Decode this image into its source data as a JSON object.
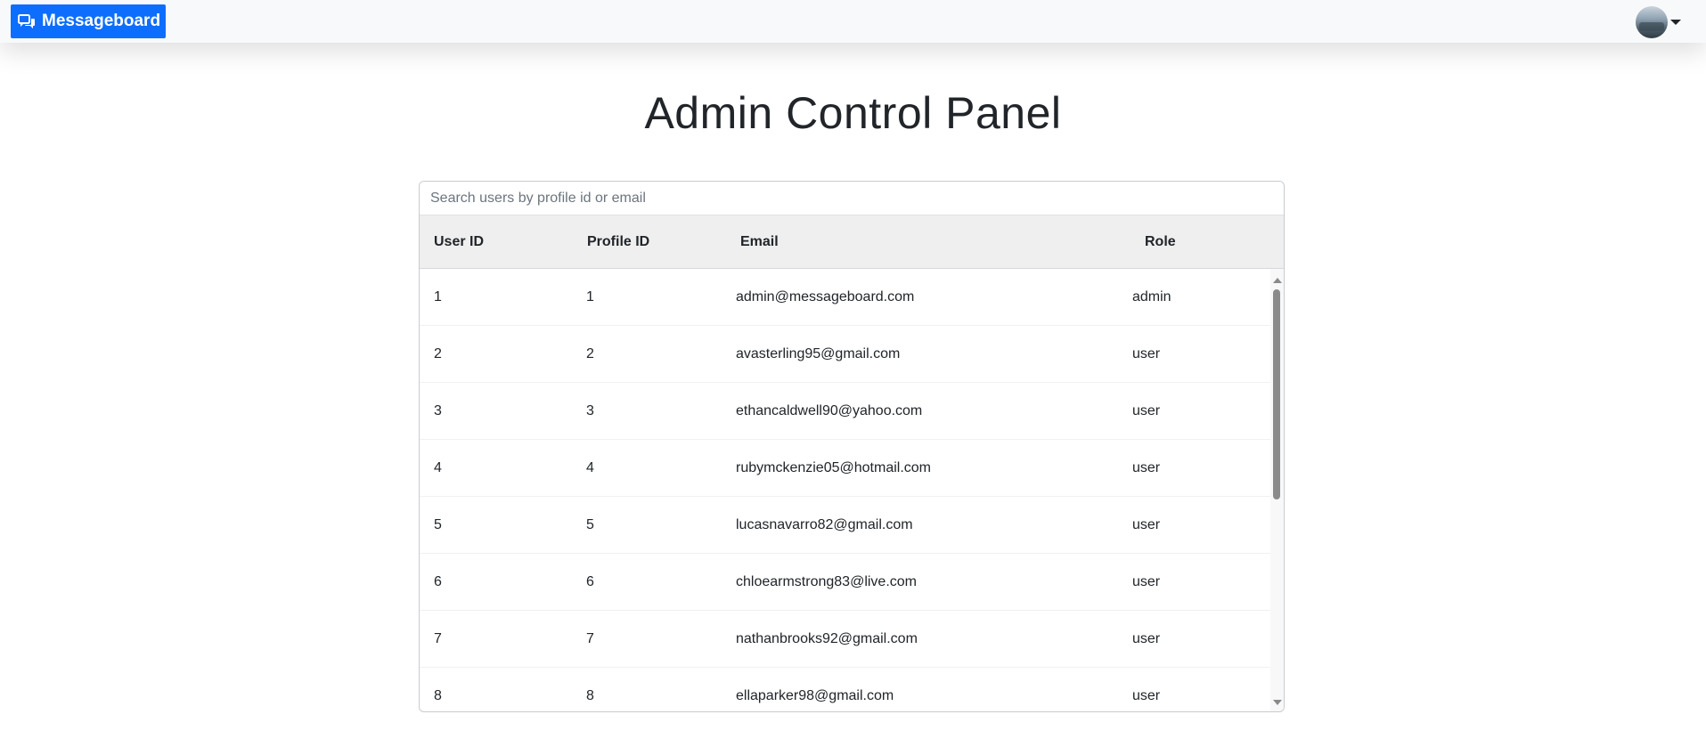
{
  "navbar": {
    "brand_label": "Messageboard",
    "brand_icon": "chat-bubbles-icon",
    "brand_color": "#0d6efd",
    "avatar_icon": "user-avatar"
  },
  "page": {
    "title": "Admin Control Panel"
  },
  "search": {
    "placeholder": "Search users by profile id or email",
    "value": ""
  },
  "table": {
    "columns": [
      "User ID",
      "Profile ID",
      "Email",
      "Role"
    ],
    "rows": [
      {
        "user_id": "1",
        "profile_id": "1",
        "email": "admin@messageboard.com",
        "role": "admin"
      },
      {
        "user_id": "2",
        "profile_id": "2",
        "email": "avasterling95@gmail.com",
        "role": "user"
      },
      {
        "user_id": "3",
        "profile_id": "3",
        "email": "ethancaldwell90@yahoo.com",
        "role": "user"
      },
      {
        "user_id": "4",
        "profile_id": "4",
        "email": "rubymckenzie05@hotmail.com",
        "role": "user"
      },
      {
        "user_id": "5",
        "profile_id": "5",
        "email": "lucasnavarro82@gmail.com",
        "role": "user"
      },
      {
        "user_id": "6",
        "profile_id": "6",
        "email": "chloearmstrong83@live.com",
        "role": "user"
      },
      {
        "user_id": "7",
        "profile_id": "7",
        "email": "nathanbrooks92@gmail.com",
        "role": "user"
      },
      {
        "user_id": "8",
        "profile_id": "8",
        "email": "ellaparker98@gmail.com",
        "role": "user"
      }
    ]
  }
}
